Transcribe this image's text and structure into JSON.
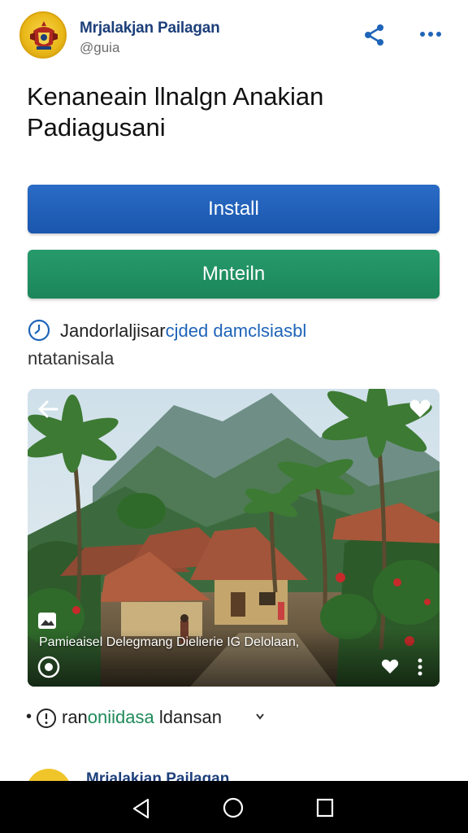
{
  "header": {
    "app_name": "Mrjalakjan Pailagan",
    "handle": "@guia",
    "logo_icon": "crest-emblem-icon",
    "share_icon": "share-icon",
    "more_icon": "more-horizontal-icon"
  },
  "title": "Kenaneain llnalgn Anakian Padiagusani",
  "buttons": {
    "install_label": "Install",
    "maintain_label": "Mnteiln"
  },
  "info": {
    "icon": "clock-icon",
    "text_plain": "Jandorlaljisar",
    "text_link": "cjded damclsiasbl",
    "subtext": "ntatanisala"
  },
  "media": {
    "caption": "Pamieaisel Delegmang Dielierie IG Delolaan,",
    "back_icon": "arrow-left-icon",
    "heart_icon": "heart-icon",
    "play_icon": "play-circle-icon",
    "kebab_icon": "more-vertical-icon"
  },
  "meta": {
    "bullet": "•",
    "prefix": "ran",
    "highlight": "oniidasa",
    "suffix": " ldansan",
    "icon": "info-circle-icon"
  },
  "next_item": {
    "app_name": "Mrjalakjan Pailagan"
  },
  "colors": {
    "install": "#1f5fb8",
    "maintain": "#20905f",
    "brand_text": "#1d3f7a",
    "link": "#1f64b8"
  }
}
